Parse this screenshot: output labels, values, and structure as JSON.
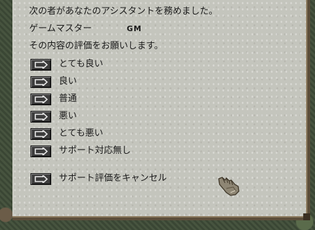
{
  "dialog": {
    "intro": "次の者があなたのアシスタントを務めました。",
    "assistant_label": "ゲームマスター",
    "assistant_value": "GM",
    "prompt": "その内容の評価をお願いします。",
    "options": [
      {
        "label": "とても良い"
      },
      {
        "label": "良い"
      },
      {
        "label": "普通"
      },
      {
        "label": "悪い"
      },
      {
        "label": "とても悪い"
      },
      {
        "label": "サポート対応無し"
      }
    ],
    "cancel_label": "サポート評価をキャンセル"
  },
  "icons": {
    "option_button": "arrow-right-icon",
    "cursor": "gauntlet-cursor-icon"
  }
}
